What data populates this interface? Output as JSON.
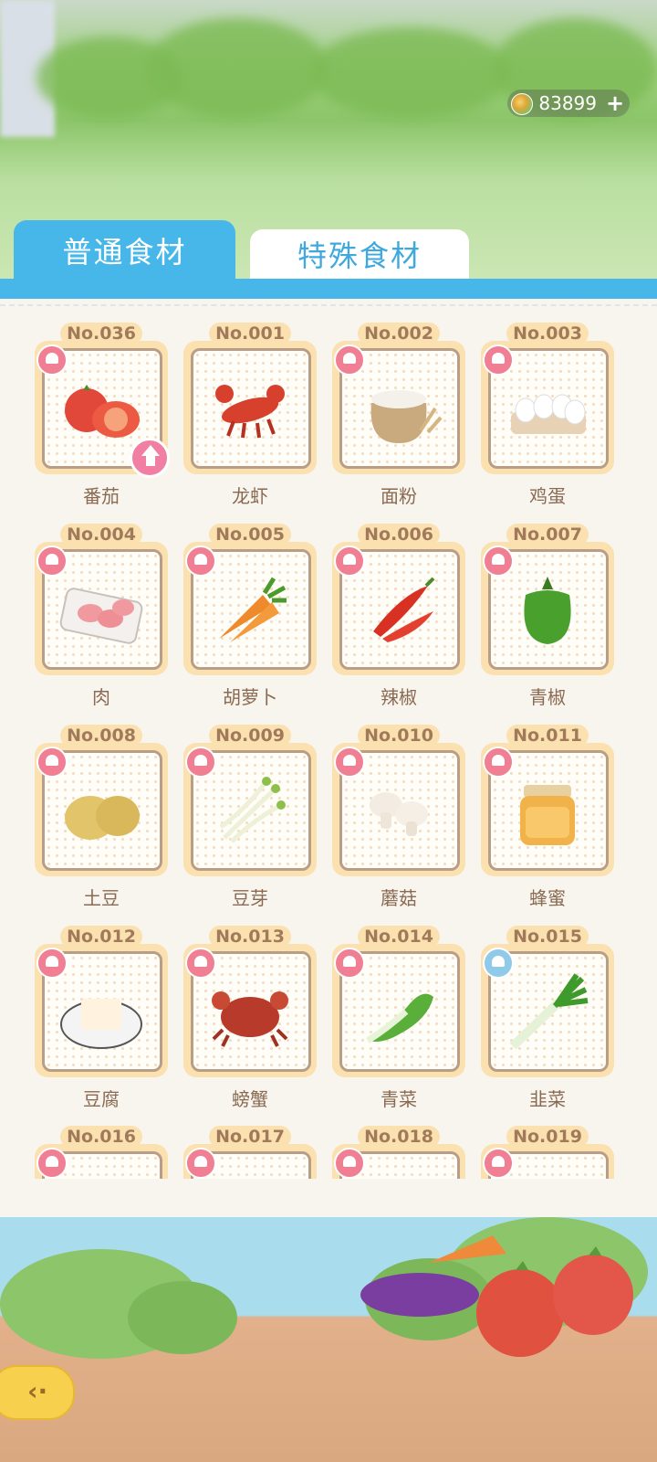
{
  "header": {
    "coins": "83899",
    "coin_icon": "coin-icon",
    "add_icon": "plus-icon"
  },
  "tabs": [
    {
      "label": "普通食材",
      "active": true
    },
    {
      "label": "特殊食材",
      "active": false
    }
  ],
  "ingredients": [
    {
      "no": "No.036",
      "name": "番茄",
      "icon": "tomato-icon",
      "badge": "pink",
      "upgrade": true
    },
    {
      "no": "No.001",
      "name": "龙虾",
      "icon": "lobster-icon",
      "badge": "none"
    },
    {
      "no": "No.002",
      "name": "面粉",
      "icon": "flour-sack-icon",
      "badge": "pink"
    },
    {
      "no": "No.003",
      "name": "鸡蛋",
      "icon": "eggs-icon",
      "badge": "pink"
    },
    {
      "no": "No.004",
      "name": "肉",
      "icon": "meat-tray-icon",
      "badge": "pink"
    },
    {
      "no": "No.005",
      "name": "胡萝卜",
      "icon": "carrot-icon",
      "badge": "pink"
    },
    {
      "no": "No.006",
      "name": "辣椒",
      "icon": "chili-icon",
      "badge": "pink"
    },
    {
      "no": "No.007",
      "name": "青椒",
      "icon": "green-pepper-icon",
      "badge": "pink"
    },
    {
      "no": "No.008",
      "name": "土豆",
      "icon": "potato-icon",
      "badge": "pink"
    },
    {
      "no": "No.009",
      "name": "豆芽",
      "icon": "bean-sprout-icon",
      "badge": "pink"
    },
    {
      "no": "No.010",
      "name": "蘑菇",
      "icon": "mushroom-icon",
      "badge": "pink"
    },
    {
      "no": "No.011",
      "name": "蜂蜜",
      "icon": "honey-jar-icon",
      "badge": "pink"
    },
    {
      "no": "No.012",
      "name": "豆腐",
      "icon": "tofu-icon",
      "badge": "pink"
    },
    {
      "no": "No.013",
      "name": "螃蟹",
      "icon": "crab-icon",
      "badge": "pink"
    },
    {
      "no": "No.014",
      "name": "青菜",
      "icon": "bok-choy-icon",
      "badge": "pink"
    },
    {
      "no": "No.015",
      "name": "韭菜",
      "icon": "leek-icon",
      "badge": "blue"
    },
    {
      "no": "No.016",
      "name": "",
      "icon": "",
      "badge": "pink"
    },
    {
      "no": "No.017",
      "name": "",
      "icon": "",
      "badge": "pink"
    },
    {
      "no": "No.018",
      "name": "",
      "icon": "",
      "badge": "pink"
    },
    {
      "no": "No.019",
      "name": "",
      "icon": "",
      "badge": "pink"
    }
  ],
  "footer": {
    "back_icon": "back-arrow-icon"
  }
}
